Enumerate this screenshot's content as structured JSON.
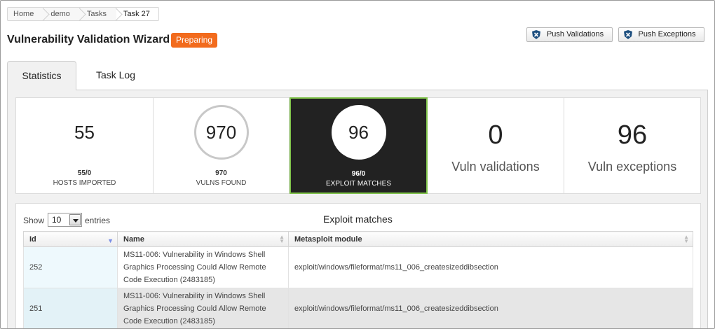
{
  "breadcrumb": [
    "Home",
    "demo",
    "Tasks",
    "Task 27"
  ],
  "page": {
    "title": "Vulnerability Validation Wizard",
    "status": "Preparing",
    "status_color": "#f26b1d"
  },
  "buttons": {
    "push_validations": "Push Validations",
    "push_exceptions": "Push Exceptions"
  },
  "tabs": {
    "statistics": "Statistics",
    "task_log": "Task Log"
  },
  "stats": {
    "hosts": {
      "value": "55",
      "sub": "55/0",
      "label": "HOSTS IMPORTED"
    },
    "vulns": {
      "value": "970",
      "sub": "970",
      "label": "VULNS FOUND"
    },
    "exploits": {
      "value": "96",
      "sub": "96/0",
      "label": "EXPLOIT MATCHES"
    },
    "validations": {
      "value": "0",
      "label": "Vuln validations"
    },
    "exceptions": {
      "value": "96",
      "label": "Vuln exceptions"
    }
  },
  "table": {
    "show_label": "Show",
    "entries_value": "10",
    "entries_label": "entries",
    "caption": "Exploit matches",
    "columns": [
      "Id",
      "Name",
      "Metasploit module"
    ],
    "rows": [
      {
        "id": "252",
        "name": "MS11-006: Vulnerability in Windows Shell Graphics Processing Could Allow Remote Code Execution (2483185)",
        "module": "exploit/windows/fileformat/ms11_006_createsizeddibsection"
      },
      {
        "id": "251",
        "name": "MS11-006: Vulnerability in Windows Shell Graphics Processing Could Allow Remote Code Execution (2483185)",
        "module": "exploit/windows/fileformat/ms11_006_createsizeddibsection"
      }
    ]
  },
  "colors": {
    "accent_highlight": "#7fc24a",
    "dark_tile": "#222222"
  }
}
